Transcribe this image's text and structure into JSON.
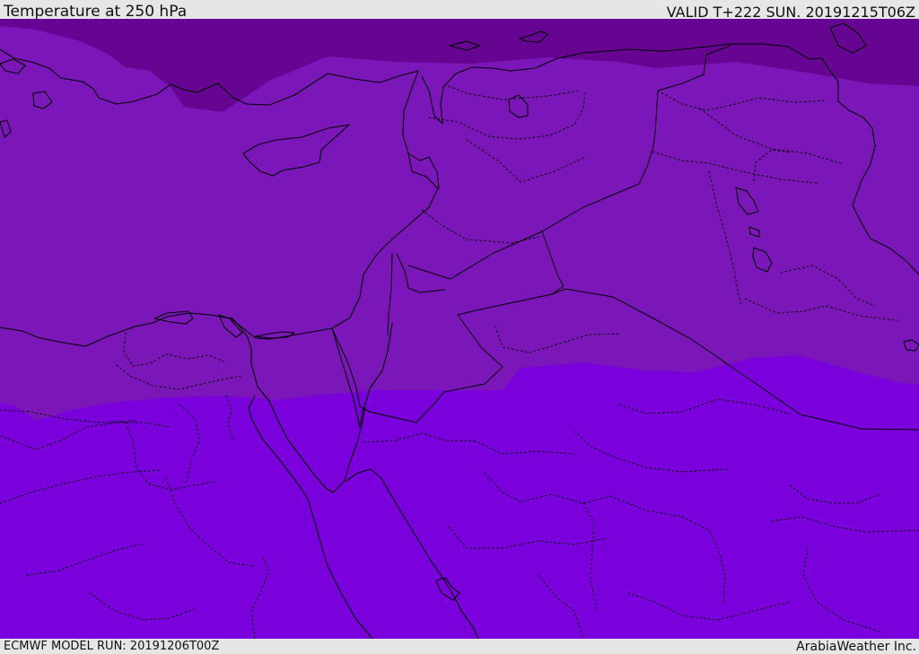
{
  "header": {
    "title": "Temperature at 250 hPa",
    "valid": "VALID T+222 SUN. 20191215T06Z"
  },
  "footer": {
    "model_run": "ECMWF MODEL RUN: 20191206T00Z",
    "credit": "ArabiaWeather Inc."
  },
  "map": {
    "colors": {
      "north_band": "#650591",
      "middle_band": "#7b16b8",
      "south_band": "#7a00dc",
      "coast_line": "#000000"
    }
  }
}
